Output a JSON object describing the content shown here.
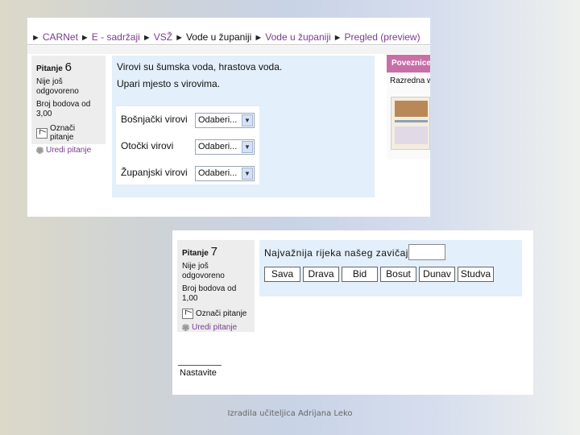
{
  "screenshot1": {
    "breadcrumb": [
      {
        "label": "CARNet",
        "link": true
      },
      {
        "label": "E - sadržaji",
        "link": true
      },
      {
        "label": "VSŽ",
        "link": true
      },
      {
        "label": "Vode u županiji",
        "link": false
      },
      {
        "label": "Vode u županiji",
        "link": true
      },
      {
        "label": "Pregled (preview)",
        "link": true
      }
    ],
    "separator": "►",
    "question_info": {
      "label": "Pitanje",
      "number": "6",
      "status": "Nije još odgovoreno",
      "points_label": "Broj bodova od",
      "points": "3,00",
      "flag_label": "Označi pitanje",
      "edit_label": "Uredi pitanje"
    },
    "question_text_1": "Virovi su šumska voda, hrastova voda.",
    "question_text_2": "Upari mjesto s virovima.",
    "matches": [
      {
        "label": "Bošnjački virovi",
        "selected": "Odaberi..."
      },
      {
        "label": "Otočki virovi",
        "selected": "Odaberi..."
      },
      {
        "label": "Županjski virovi",
        "selected": "Odaberi..."
      }
    ],
    "side_block": {
      "title": "Poveznice",
      "text": "Razredna w"
    }
  },
  "screenshot2": {
    "question_info": {
      "label": "Pitanje",
      "number": "7",
      "status": "Nije još odgovoreno",
      "points_label": "Broj bodova od",
      "points": "1,00",
      "flag_label": "Označi pitanje",
      "edit_label": "Uredi pitanje"
    },
    "prompt": "Najvažnija rijeka našeg zavičaja je",
    "answer_value": "",
    "choices": [
      "Sava",
      "Drava",
      "Bid",
      "Bosut",
      "Dunav",
      "Studva"
    ],
    "continue_label": "Nastavite"
  },
  "footer": "Izradila učiteljica Adrijana Leko"
}
